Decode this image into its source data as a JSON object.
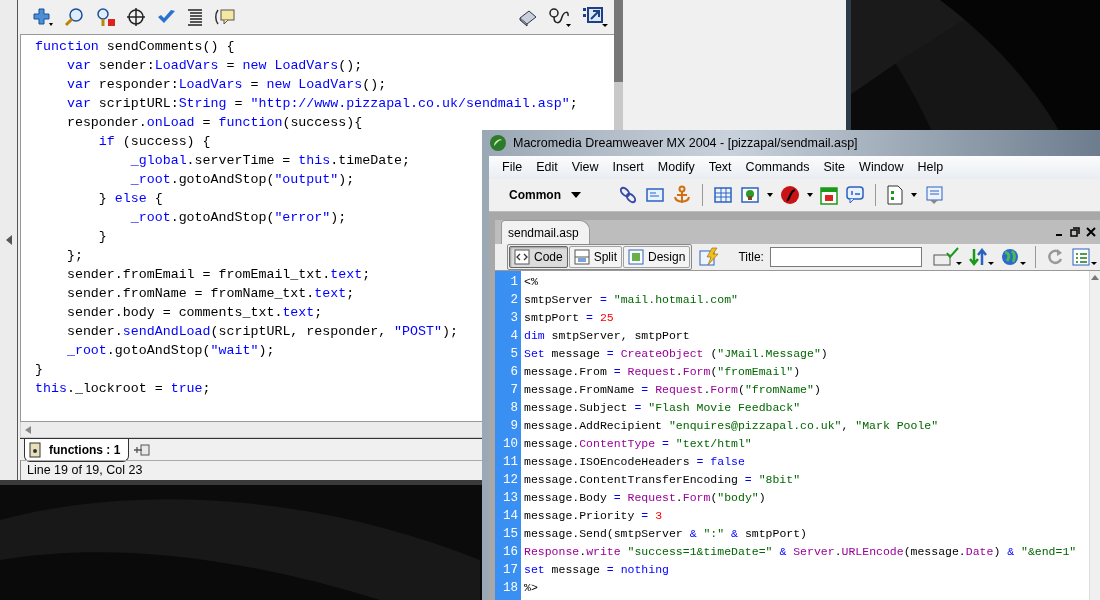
{
  "flash_panel": {
    "code_lines": [
      [
        {
          "kind": "keyword",
          "text": "function"
        },
        {
          "kind": "plain",
          "text": " sendComments() {"
        }
      ],
      [
        {
          "kind": "keyword",
          "text": "    var"
        },
        {
          "kind": "plain",
          "text": " sender:"
        },
        {
          "kind": "keyword",
          "text": "LoadVars"
        },
        {
          "kind": "plain",
          "text": " = "
        },
        {
          "kind": "keyword",
          "text": "new LoadVars"
        },
        {
          "kind": "plain",
          "text": "();"
        }
      ],
      [
        {
          "kind": "keyword",
          "text": "    var"
        },
        {
          "kind": "plain",
          "text": " responder:"
        },
        {
          "kind": "keyword",
          "text": "LoadVars"
        },
        {
          "kind": "plain",
          "text": " = "
        },
        {
          "kind": "keyword",
          "text": "new LoadVars"
        },
        {
          "kind": "plain",
          "text": "();"
        }
      ],
      [
        {
          "kind": "keyword",
          "text": "    var"
        },
        {
          "kind": "plain",
          "text": " scriptURL:"
        },
        {
          "kind": "keyword",
          "text": "String"
        },
        {
          "kind": "plain",
          "text": " = "
        },
        {
          "kind": "keyword",
          "text": "\"http://www.pizzapal.co.uk/sendmail.asp\""
        },
        {
          "kind": "plain",
          "text": ";"
        }
      ],
      [
        {
          "kind": "plain",
          "text": "    responder."
        },
        {
          "kind": "keyword",
          "text": "onLoad"
        },
        {
          "kind": "plain",
          "text": " = "
        },
        {
          "kind": "keyword",
          "text": "function"
        },
        {
          "kind": "plain",
          "text": "(success){"
        }
      ],
      [
        {
          "kind": "keyword",
          "text": "        if"
        },
        {
          "kind": "plain",
          "text": " (success) {"
        }
      ],
      [
        {
          "kind": "keyword",
          "text": "            _global"
        },
        {
          "kind": "plain",
          "text": ".serverTime = "
        },
        {
          "kind": "keyword",
          "text": "this"
        },
        {
          "kind": "plain",
          "text": ".timeDate;"
        }
      ],
      [
        {
          "kind": "keyword",
          "text": "            _root"
        },
        {
          "kind": "plain",
          "text": ".gotoAndStop("
        },
        {
          "kind": "keyword",
          "text": "\"output\""
        },
        {
          "kind": "plain",
          "text": ");"
        }
      ],
      [
        {
          "kind": "plain",
          "text": "        } "
        },
        {
          "kind": "keyword",
          "text": "else"
        },
        {
          "kind": "plain",
          "text": " {"
        }
      ],
      [
        {
          "kind": "keyword",
          "text": "            _root"
        },
        {
          "kind": "plain",
          "text": ".gotoAndStop("
        },
        {
          "kind": "keyword",
          "text": "\"error\""
        },
        {
          "kind": "plain",
          "text": ");"
        }
      ],
      [
        {
          "kind": "plain",
          "text": "        }"
        }
      ],
      [
        {
          "kind": "plain",
          "text": "    };"
        }
      ],
      [
        {
          "kind": "plain",
          "text": "    sender.fromEmail = fromEmail_txt."
        },
        {
          "kind": "keyword",
          "text": "text"
        },
        {
          "kind": "plain",
          "text": ";"
        }
      ],
      [
        {
          "kind": "plain",
          "text": "    sender.fromName = fromName_txt."
        },
        {
          "kind": "keyword",
          "text": "text"
        },
        {
          "kind": "plain",
          "text": ";"
        }
      ],
      [
        {
          "kind": "plain",
          "text": "    sender.body = comments_txt."
        },
        {
          "kind": "keyword",
          "text": "text"
        },
        {
          "kind": "plain",
          "text": ";"
        }
      ],
      [
        {
          "kind": "plain",
          "text": "    sender."
        },
        {
          "kind": "keyword",
          "text": "sendAndLoad"
        },
        {
          "kind": "plain",
          "text": "(scriptURL, responder, "
        },
        {
          "kind": "keyword",
          "text": "\"POST\""
        },
        {
          "kind": "plain",
          "text": ");"
        }
      ],
      [
        {
          "kind": "keyword",
          "text": "    _root"
        },
        {
          "kind": "plain",
          "text": ".gotoAndStop("
        },
        {
          "kind": "keyword",
          "text": "\"wait\""
        },
        {
          "kind": "plain",
          "text": ");"
        }
      ],
      [
        {
          "kind": "plain",
          "text": "}"
        }
      ],
      [
        {
          "kind": "keyword",
          "text": "this"
        },
        {
          "kind": "plain",
          "text": "._lockroot = "
        },
        {
          "kind": "keyword",
          "text": "true"
        },
        {
          "kind": "plain",
          "text": ";"
        }
      ]
    ],
    "tab": {
      "label": "functions : 1",
      "selected": true
    },
    "status_bar": "Line 19 of 19, Col 23"
  },
  "dreamweaver": {
    "title": "Macromedia Dreamweaver MX 2004 - [pizzapal/sendmail.asp]",
    "menu": [
      "File",
      "Edit",
      "View",
      "Insert",
      "Modify",
      "Text",
      "Commands",
      "Site",
      "Window",
      "Help"
    ],
    "insert_bar": {
      "category": "Common"
    },
    "document": {
      "tab": "sendmail.asp",
      "view_buttons": [
        {
          "label": "Code",
          "selected": true
        },
        {
          "label": "Split",
          "selected": false
        },
        {
          "label": "Design",
          "selected": false
        }
      ],
      "title_label": "Title:",
      "code_lines": [
        {
          "number": "1",
          "tokens": [
            {
              "kind": "plain",
              "text": "<%"
            }
          ]
        },
        {
          "number": "2",
          "tokens": [
            {
              "kind": "plain",
              "text": "smtpServer"
            },
            {
              "kind": "operator",
              "text": " = "
            },
            {
              "kind": "string",
              "text": "\"mail.hotmail.com\""
            }
          ]
        },
        {
          "number": "3",
          "tokens": [
            {
              "kind": "plain",
              "text": "smtpPort"
            },
            {
              "kind": "operator",
              "text": " = "
            },
            {
              "kind": "number",
              "text": "25"
            }
          ]
        },
        {
          "number": "4",
          "tokens": [
            {
              "kind": "keyword",
              "text": "dim"
            },
            {
              "kind": "plain",
              "text": " smtpServer, smtpPort"
            }
          ]
        },
        {
          "number": "5",
          "tokens": [
            {
              "kind": "keyword",
              "text": "Set"
            },
            {
              "kind": "plain",
              "text": " message "
            },
            {
              "kind": "operator",
              "text": "= "
            },
            {
              "kind": "object",
              "text": "CreateObject"
            },
            {
              "kind": "plain",
              "text": " ("
            },
            {
              "kind": "string",
              "text": "\"JMail.Message\""
            },
            {
              "kind": "plain",
              "text": ")"
            }
          ]
        },
        {
          "number": "6",
          "tokens": [
            {
              "kind": "plain",
              "text": "message.From"
            },
            {
              "kind": "operator",
              "text": " = "
            },
            {
              "kind": "object",
              "text": "Request"
            },
            {
              "kind": "plain",
              "text": "."
            },
            {
              "kind": "object",
              "text": "Form"
            },
            {
              "kind": "plain",
              "text": "("
            },
            {
              "kind": "string",
              "text": "\"fromEmail\""
            },
            {
              "kind": "plain",
              "text": ")"
            }
          ]
        },
        {
          "number": "7",
          "tokens": [
            {
              "kind": "plain",
              "text": "message.FromName"
            },
            {
              "kind": "operator",
              "text": " = "
            },
            {
              "kind": "object",
              "text": "Request"
            },
            {
              "kind": "plain",
              "text": "."
            },
            {
              "kind": "object",
              "text": "Form"
            },
            {
              "kind": "plain",
              "text": "("
            },
            {
              "kind": "string",
              "text": "\"fromName\""
            },
            {
              "kind": "plain",
              "text": ")"
            }
          ]
        },
        {
          "number": "8",
          "tokens": [
            {
              "kind": "plain",
              "text": "message.Subject"
            },
            {
              "kind": "operator",
              "text": " = "
            },
            {
              "kind": "string",
              "text": "\"Flash Movie Feedback\""
            }
          ]
        },
        {
          "number": "9",
          "tokens": [
            {
              "kind": "plain",
              "text": "message.AddRecipient "
            },
            {
              "kind": "string",
              "text": "\"enquires@pizzapal.co.uk\""
            },
            {
              "kind": "plain",
              "text": ", "
            },
            {
              "kind": "string",
              "text": "\"Mark Poole\""
            }
          ]
        },
        {
          "number": "10",
          "tokens": [
            {
              "kind": "plain",
              "text": "message."
            },
            {
              "kind": "object",
              "text": "ContentType"
            },
            {
              "kind": "operator",
              "text": " = "
            },
            {
              "kind": "string",
              "text": "\"text/html\""
            }
          ]
        },
        {
          "number": "11",
          "tokens": [
            {
              "kind": "plain",
              "text": "message.ISOEncodeHeaders"
            },
            {
              "kind": "operator",
              "text": " = "
            },
            {
              "kind": "keyword",
              "text": "false"
            }
          ]
        },
        {
          "number": "12",
          "tokens": [
            {
              "kind": "plain",
              "text": "message.ContentTransferEncoding"
            },
            {
              "kind": "operator",
              "text": " = "
            },
            {
              "kind": "string",
              "text": "\"8bit\""
            }
          ]
        },
        {
          "number": "13",
          "tokens": [
            {
              "kind": "plain",
              "text": "message.Body"
            },
            {
              "kind": "operator",
              "text": " = "
            },
            {
              "kind": "object",
              "text": "Request"
            },
            {
              "kind": "plain",
              "text": "."
            },
            {
              "kind": "object",
              "text": "Form"
            },
            {
              "kind": "plain",
              "text": "("
            },
            {
              "kind": "string",
              "text": "\"body\""
            },
            {
              "kind": "plain",
              "text": ")"
            }
          ]
        },
        {
          "number": "14",
          "tokens": [
            {
              "kind": "plain",
              "text": "message.Priority"
            },
            {
              "kind": "operator",
              "text": " = "
            },
            {
              "kind": "number",
              "text": "3"
            }
          ]
        },
        {
          "number": "15",
          "tokens": [
            {
              "kind": "plain",
              "text": "message.Send(smtpServer"
            },
            {
              "kind": "operator",
              "text": " & "
            },
            {
              "kind": "string",
              "text": "\":\""
            },
            {
              "kind": "operator",
              "text": " & "
            },
            {
              "kind": "plain",
              "text": "smtpPort)"
            }
          ]
        },
        {
          "number": "16",
          "tokens": [
            {
              "kind": "object",
              "text": "Response"
            },
            {
              "kind": "plain",
              "text": "."
            },
            {
              "kind": "object",
              "text": "write "
            },
            {
              "kind": "string",
              "text": "\"success=1&timeDate=\""
            },
            {
              "kind": "operator",
              "text": " & "
            },
            {
              "kind": "object",
              "text": "Server"
            },
            {
              "kind": "plain",
              "text": "."
            },
            {
              "kind": "object",
              "text": "URLEncode"
            },
            {
              "kind": "plain",
              "text": "(message."
            },
            {
              "kind": "object",
              "text": "Date"
            },
            {
              "kind": "plain",
              "text": ")"
            },
            {
              "kind": "operator",
              "text": " & "
            },
            {
              "kind": "string",
              "text": "\"&end=1\""
            }
          ]
        },
        {
          "number": "17",
          "tokens": [
            {
              "kind": "keyword",
              "text": "set"
            },
            {
              "kind": "plain",
              "text": " message "
            },
            {
              "kind": "operator",
              "text": "="
            },
            {
              "kind": "keyword",
              "text": " nothing"
            }
          ]
        },
        {
          "number": "18",
          "tokens": [
            {
              "kind": "plain",
              "text": "%>"
            }
          ]
        }
      ]
    }
  }
}
